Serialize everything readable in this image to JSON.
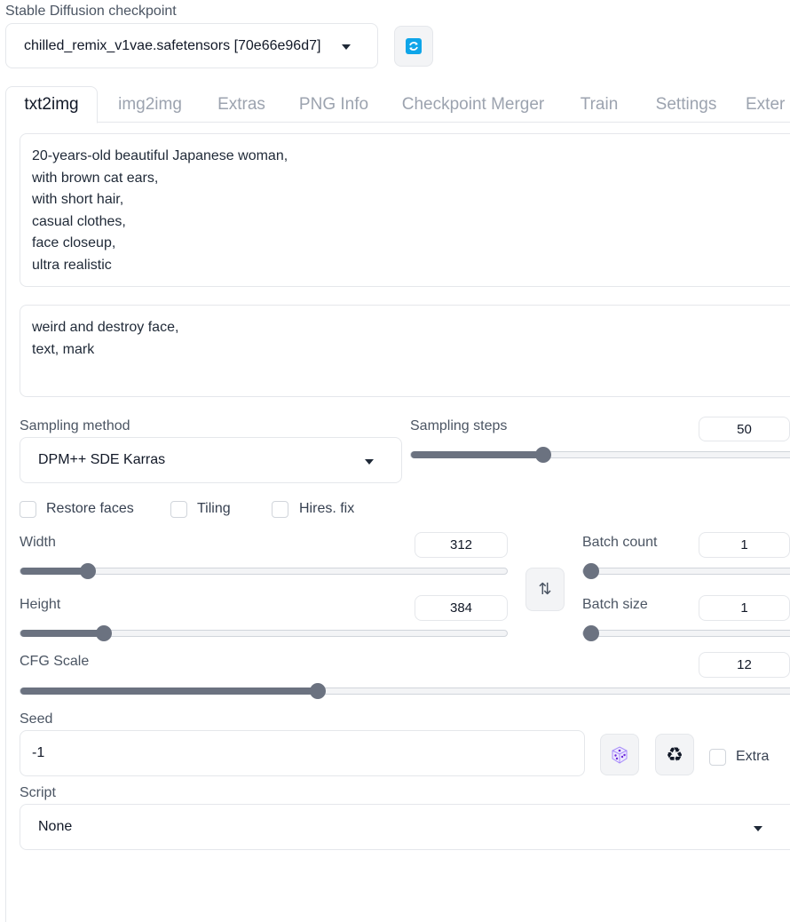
{
  "checkpoint": {
    "label": "Stable Diffusion checkpoint",
    "value": "chilled_remix_v1vae.safetensors [70e66e96d7]"
  },
  "tabs": [
    {
      "label": "txt2img",
      "active": true
    },
    {
      "label": "img2img"
    },
    {
      "label": "Extras"
    },
    {
      "label": "PNG Info"
    },
    {
      "label": "Checkpoint Merger"
    },
    {
      "label": "Train"
    },
    {
      "label": "Settings"
    },
    {
      "label": "Exter"
    }
  ],
  "prompt": {
    "lines": [
      "20-years-old beautiful Japanese woman,",
      "with brown cat ears,",
      "with short hair,",
      "casual clothes,",
      "face closeup,",
      "ultra realistic"
    ]
  },
  "negative_prompt": {
    "lines": [
      "weird and destroy face,",
      "text, mark"
    ]
  },
  "sampling_method": {
    "label": "Sampling method",
    "value": "DPM++ SDE Karras"
  },
  "sampling_steps": {
    "label": "Sampling steps",
    "value": "50",
    "fraction": 0.34
  },
  "checkboxes": {
    "restore_faces": "Restore faces",
    "tiling": "Tiling",
    "hires_fix": "Hires. fix"
  },
  "width": {
    "label": "Width",
    "value": "312",
    "fraction": 0.138
  },
  "height": {
    "label": "Height",
    "value": "384",
    "fraction": 0.172
  },
  "swap_icon": "⇅",
  "batch_count": {
    "label": "Batch count",
    "value": "1",
    "fraction": 0.0
  },
  "batch_size": {
    "label": "Batch size",
    "value": "1",
    "fraction": 0.0
  },
  "cfg_scale": {
    "label": "CFG Scale",
    "value": "12",
    "fraction": 0.382
  },
  "seed": {
    "label": "Seed",
    "value": "-1",
    "extra_label": "Extra"
  },
  "script": {
    "label": "Script",
    "value": "None"
  },
  "colors": {
    "refresh_icon": "#0ea5e9",
    "slider": "#6b7280"
  }
}
